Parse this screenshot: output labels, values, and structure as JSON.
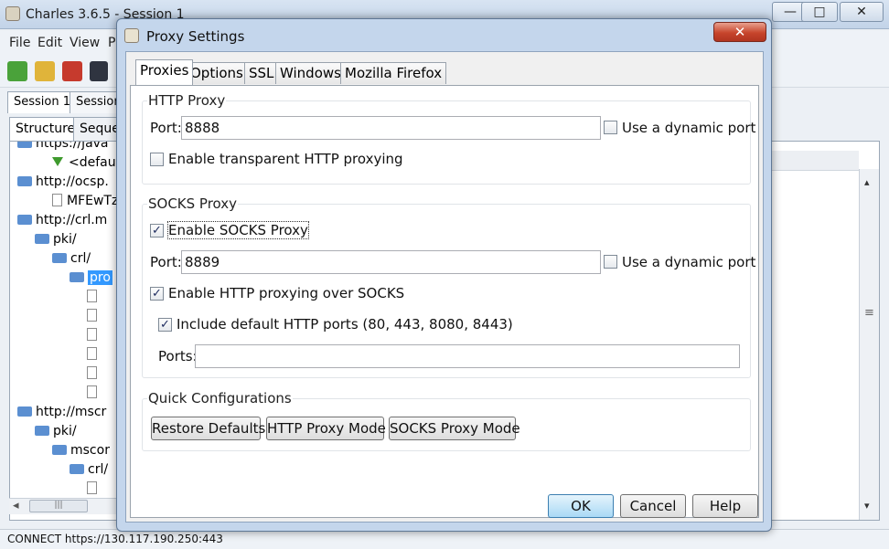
{
  "main_window": {
    "title": "Charles 3.6.5 - Session 1",
    "controls": {
      "minimize": "—",
      "maximize": "□",
      "close": "✕"
    },
    "menu": [
      "File",
      "Edit",
      "View",
      "P"
    ],
    "session_tabs": [
      "Session 1",
      "Session"
    ],
    "panel_tabs": [
      "Structure",
      "Seque"
    ],
    "tree": [
      {
        "label": "https://java",
        "kind": "folder",
        "indent": 0
      },
      {
        "label": "<default",
        "kind": "arrow",
        "indent": 2
      },
      {
        "label": "http://ocsp.",
        "kind": "folder",
        "indent": 0
      },
      {
        "label": "MFEwTz",
        "kind": "file",
        "indent": 2
      },
      {
        "label": "http://crl.m",
        "kind": "folder",
        "indent": 0
      },
      {
        "label": "pki/",
        "kind": "folder",
        "indent": 1
      },
      {
        "label": "crl/",
        "kind": "folder",
        "indent": 2
      },
      {
        "label": "pro",
        "kind": "folder",
        "indent": 3,
        "selected": true
      },
      {
        "label": "",
        "kind": "file",
        "indent": 4
      },
      {
        "label": "",
        "kind": "file",
        "indent": 4
      },
      {
        "label": "",
        "kind": "file",
        "indent": 4
      },
      {
        "label": "",
        "kind": "file",
        "indent": 4
      },
      {
        "label": "",
        "kind": "file",
        "indent": 4
      },
      {
        "label": "",
        "kind": "file",
        "indent": 4
      },
      {
        "label": "http://mscr",
        "kind": "folder",
        "indent": 0
      },
      {
        "label": "pki/",
        "kind": "folder",
        "indent": 1
      },
      {
        "label": "mscor",
        "kind": "folder",
        "indent": 2
      },
      {
        "label": "crl/",
        "kind": "folder",
        "indent": 3
      },
      {
        "label": "",
        "kind": "file",
        "indent": 4
      }
    ],
    "status": "CONNECT https://130.117.190.250:443"
  },
  "dialog": {
    "title": "Proxy Settings",
    "close_glyph": "✕",
    "tabs": [
      "Proxies",
      "Options",
      "SSL",
      "Windows",
      "Mozilla Firefox"
    ],
    "http_proxy": {
      "title": "HTTP Proxy",
      "port_label": "Port:",
      "port_value": "8888",
      "dynamic_port_label": "Use a dynamic port",
      "dynamic_port_checked": false,
      "transparent_label": "Enable transparent HTTP proxying",
      "transparent_checked": false
    },
    "socks_proxy": {
      "title": "SOCKS Proxy",
      "enable_label": "Enable SOCKS Proxy",
      "enable_checked": true,
      "port_label": "Port:",
      "port_value": "8889",
      "dynamic_port_label": "Use a dynamic port",
      "dynamic_port_checked": false,
      "http_over_socks_label": "Enable HTTP proxying over SOCKS",
      "http_over_socks_checked": true,
      "default_ports_label": "Include default HTTP ports (80, 443, 8080, 8443)",
      "default_ports_checked": true,
      "ports_label": "Ports:",
      "ports_value": ""
    },
    "quick_config": {
      "title": "Quick Configurations",
      "buttons": [
        "Restore Defaults",
        "HTTP Proxy Mode",
        "SOCKS Proxy Mode"
      ]
    },
    "footer": {
      "ok": "OK",
      "cancel": "Cancel",
      "help": "Help"
    }
  },
  "check_glyph": "✓",
  "scroll_glyphs": {
    "left": "◂",
    "thumb": "|||",
    "up": "▴",
    "down": "▾",
    "grip": "≡"
  }
}
